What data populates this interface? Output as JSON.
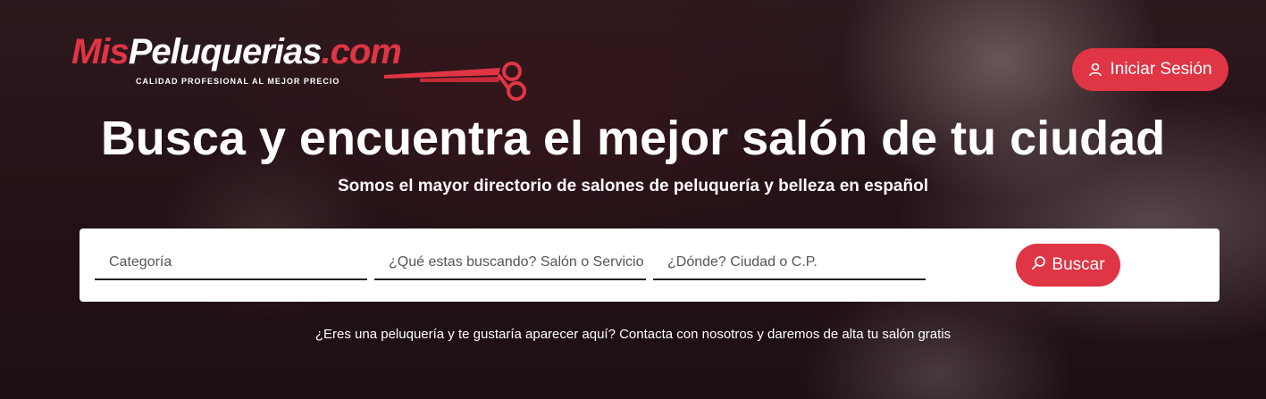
{
  "logo": {
    "part_mis": "Mis",
    "part_peluquerias": "Peluquerias",
    "part_com": ".com",
    "tagline": "CALIDAD PROFESIONAL AL MEJOR PRECIO",
    "icon": "scissors-icon"
  },
  "header": {
    "login_label": "Iniciar Sesión",
    "login_icon": "user-icon"
  },
  "hero": {
    "title": "Busca y encuentra el mejor salón de tu ciudad",
    "subtitle": "Somos el mayor directorio de salones de peluquería y belleza en español"
  },
  "search": {
    "category_placeholder": "Categoría",
    "what_placeholder": "¿Qué estas buscando? Salón o Servicio",
    "where_placeholder": "¿Dónde? Ciudad o C.P.",
    "button_label": "Buscar",
    "button_icon": "search-icon"
  },
  "footer_note": "¿Eres una peluquería y te gustaría aparecer aquí? Contacta con nosotros y daremos de alta tu salón gratis",
  "colors": {
    "accent": "#e03545",
    "text_light": "#ffffff"
  }
}
